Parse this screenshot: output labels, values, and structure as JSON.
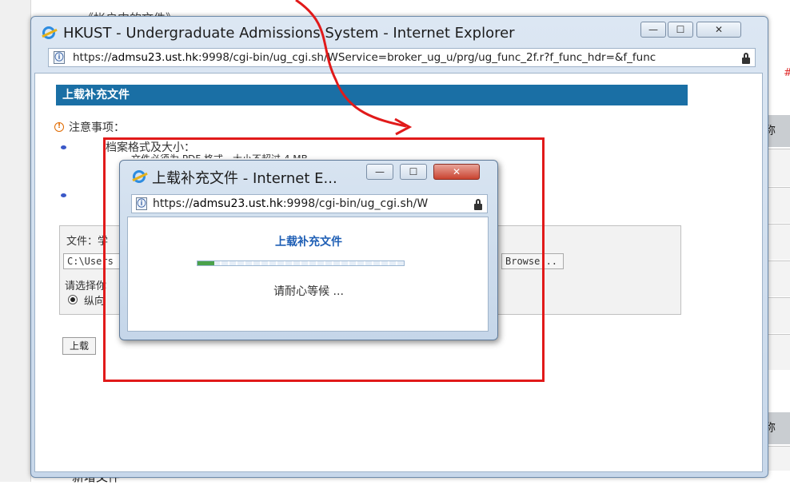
{
  "background": {
    "top_text": "《帐户中的文件》",
    "right_header_1": "称",
    "right_header_2": "称",
    "bottom_text": "新增文件",
    "marker": "#"
  },
  "main_window": {
    "title": "HKUST - Undergraduate Admissions System - Internet Explorer",
    "url_prefix": "https://",
    "url_host": "admsu23.ust.hk",
    "url_rest": ":9998/cgi-bin/ug_cgi.sh/WService=broker_ug_u/prg/ug_func_2f.r?f_func_hdr=&f_func",
    "minimize_label": "—",
    "maximize_label": "☐",
    "close_label": "✕"
  },
  "page": {
    "section_title": "上载补充文件",
    "notes_title": "注意事项：",
    "note1": "档案格式及大小：",
    "note1_sub": "文件必须为 PDF 格式，大小不超过 4 MB",
    "file_label": "文件：学",
    "file_input_value": "C:\\Users",
    "browse_label": "Browse...",
    "orientation_label": "请选择你",
    "orientation_option": "纵向",
    "upload_button": "上载"
  },
  "popup": {
    "title": "上载补充文件 - Internet E...",
    "url_prefix": "https://",
    "url_host": "admsu23.ust.hk",
    "url_rest": ":9998/cgi-bin/ug_cgi.sh/W",
    "heading": "上载补充文件",
    "wait_text": "请耐心等候 ...",
    "progress_fraction": 0.08,
    "minimize_label": "—",
    "maximize_label": "☐",
    "close_label": "✕"
  },
  "colors": {
    "section_header": "#1a6fa5",
    "annotation": "#e11a1a",
    "progress": "#4aa24a",
    "heading_text": "#1f5fb5"
  }
}
